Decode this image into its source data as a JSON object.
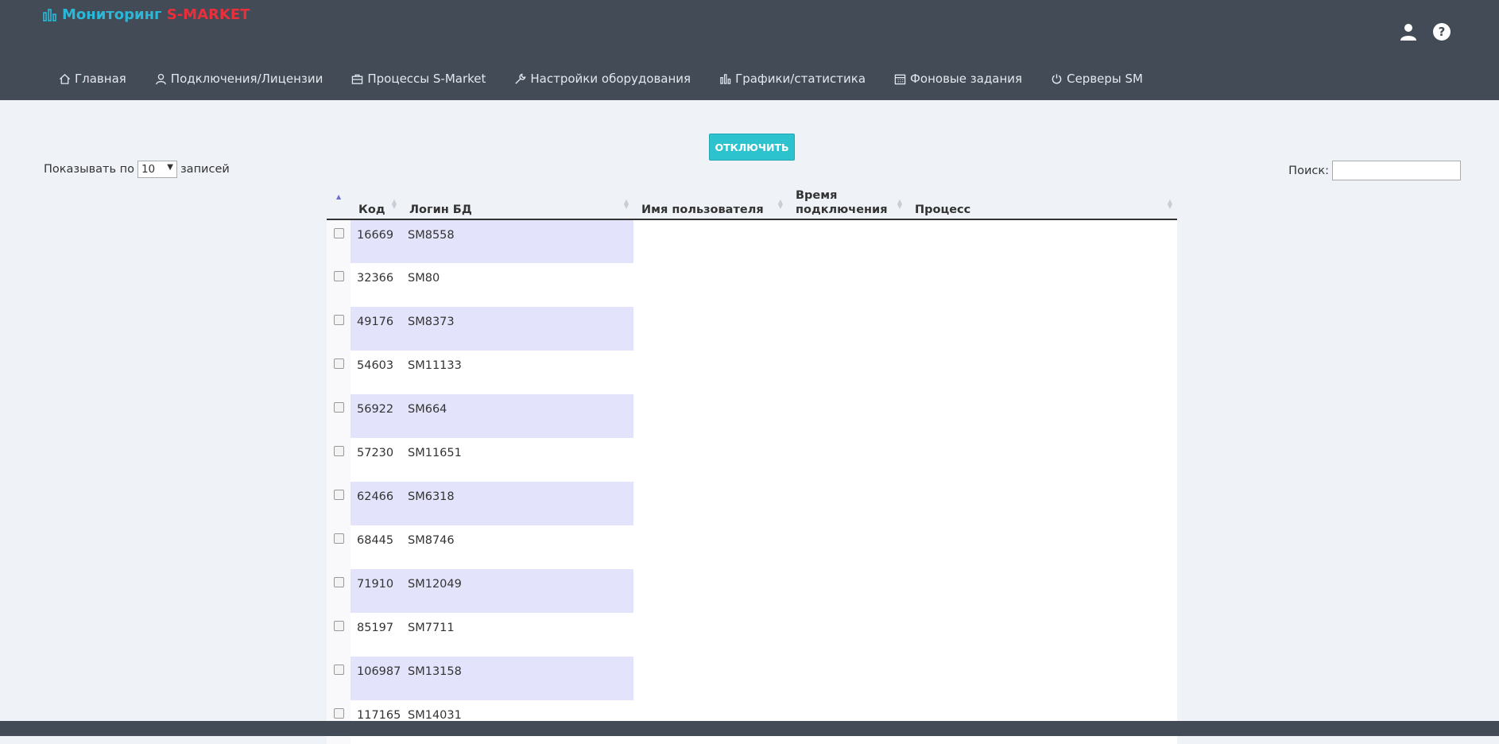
{
  "brand": {
    "title_main": "Мониторинг ",
    "title_accent": "S-MARKET",
    "icon": "bar-chart-icon"
  },
  "header_icons": [
    {
      "name": "user-icon"
    },
    {
      "name": "help-icon"
    }
  ],
  "nav": [
    {
      "label": "Главная",
      "icon": "home-icon"
    },
    {
      "label": "Подключения/Лицензии",
      "icon": "user-outline-icon"
    },
    {
      "label": "Процессы S-Market",
      "icon": "briefcase-icon"
    },
    {
      "label": "Настройки оборудования",
      "icon": "wrench-icon"
    },
    {
      "label": "Графики/статистика",
      "icon": "bar-chart-icon"
    },
    {
      "label": "Фоновые задания",
      "icon": "calendar-icon"
    },
    {
      "label": "Серверы SM",
      "icon": "power-icon"
    }
  ],
  "toolbar": {
    "disconnect_label": "ОТКЛЮЧИТЬ"
  },
  "length": {
    "prefix": "Показывать по",
    "value": "10",
    "suffix": "записей"
  },
  "search": {
    "label": "Поиск:",
    "value": ""
  },
  "table": {
    "columns": [
      "",
      "Код",
      "Логин БД",
      "Имя пользователя",
      "Время подключения",
      "Процесс"
    ],
    "rows": [
      {
        "code": "16669",
        "login": "SM8558"
      },
      {
        "code": "32366",
        "login": "SM80"
      },
      {
        "code": "49176",
        "login": "SM8373"
      },
      {
        "code": "54603",
        "login": "SM11133"
      },
      {
        "code": "56922",
        "login": "SM664"
      },
      {
        "code": "57230",
        "login": "SM11651"
      },
      {
        "code": "62466",
        "login": "SM6318"
      },
      {
        "code": "68445",
        "login": "SM8746"
      },
      {
        "code": "71910",
        "login": "SM12049"
      },
      {
        "code": "85197",
        "login": "SM7711"
      },
      {
        "code": "106987",
        "login": "SM13158"
      },
      {
        "code": "117165",
        "login": "SM14031"
      }
    ]
  },
  "colors": {
    "header_bg": "#434b56",
    "accent": "#2bb8d8",
    "brand_red": "#e8303c",
    "button": "#2cc3cf",
    "row_highlight": "#e3e4fb"
  }
}
